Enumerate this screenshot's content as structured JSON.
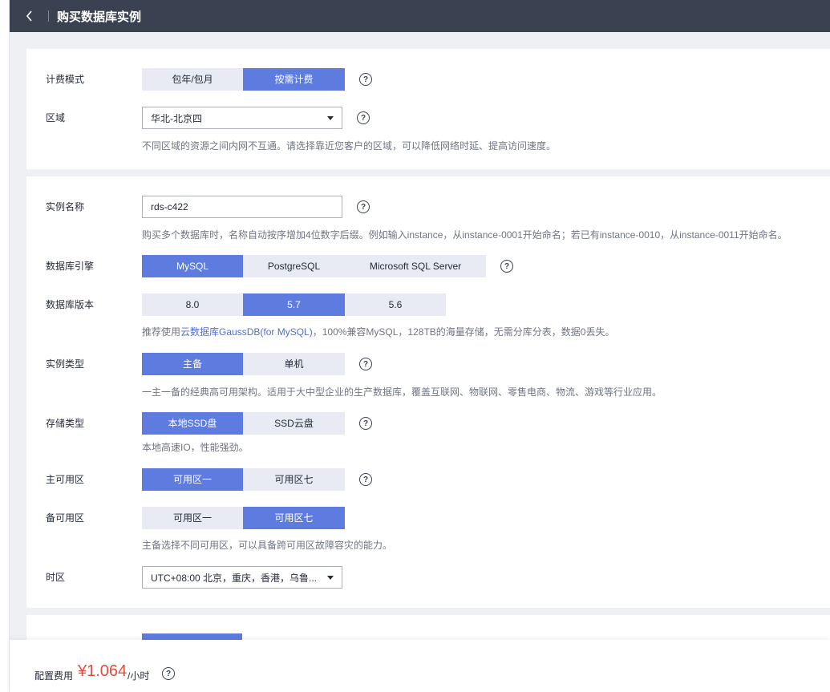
{
  "header": {
    "title": "购买数据库实例"
  },
  "billing": {
    "label": "计费模式",
    "options": [
      "包年/包月",
      "按需计费"
    ],
    "selected": 1
  },
  "region": {
    "label": "区域",
    "value": "华北-北京四",
    "hint": "不同区域的资源之间内网不互通。请选择靠近您客户的区域，可以降低网络时延、提高访问速度。"
  },
  "instance_name": {
    "label": "实例名称",
    "value": "rds-c422",
    "hint": "购买多个数据库时，名称自动按序增加4位数字后缀。例如输入instance，从instance-0001开始命名；若已有instance-0010，从instance-0011开始命名。"
  },
  "engine": {
    "label": "数据库引擎",
    "options": [
      "MySQL",
      "PostgreSQL",
      "Microsoft SQL Server"
    ],
    "selected": 0
  },
  "version": {
    "label": "数据库版本",
    "options": [
      "8.0",
      "5.7",
      "5.6"
    ],
    "selected": 1,
    "hint_prefix": "推荐使用",
    "hint_link": "云数据库GaussDB(for MySQL)",
    "hint_suffix": "，100%兼容MySQL，128TB的海量存储，无需分库分表，数据0丢失。"
  },
  "instance_type": {
    "label": "实例类型",
    "options": [
      "主备",
      "单机"
    ],
    "selected": 0,
    "hint": "一主一备的经典高可用架构。适用于大中型企业的生产数据库，覆盖互联网、物联网、零售电商、物流、游戏等行业应用。"
  },
  "storage_type": {
    "label": "存储类型",
    "options": [
      "本地SSD盘",
      "SSD云盘"
    ],
    "selected": 0,
    "hint": "本地高速IO，性能强劲。"
  },
  "primary_az": {
    "label": "主可用区",
    "options": [
      "可用区一",
      "可用区七"
    ],
    "selected": 0
  },
  "standby_az": {
    "label": "备可用区",
    "options": [
      "可用区一",
      "可用区七"
    ],
    "selected": 1,
    "hint": "主备选择不同可用区，可以具备跨可用区故障容灾的能力。"
  },
  "timezone": {
    "label": "时区",
    "value": "UTC+08:00 北京，重庆，香港，乌鲁..."
  },
  "footer": {
    "fee_label": "配置费用",
    "fee_value": "¥1.064",
    "fee_unit": "/小时"
  },
  "colors": {
    "primary": "#5e7ce0",
    "header_bg": "#3a4150",
    "price": "#e74c3c"
  },
  "icons": {
    "back": "chevron-left-icon",
    "help": "question-circle-icon",
    "dropdown": "caret-down-icon"
  }
}
